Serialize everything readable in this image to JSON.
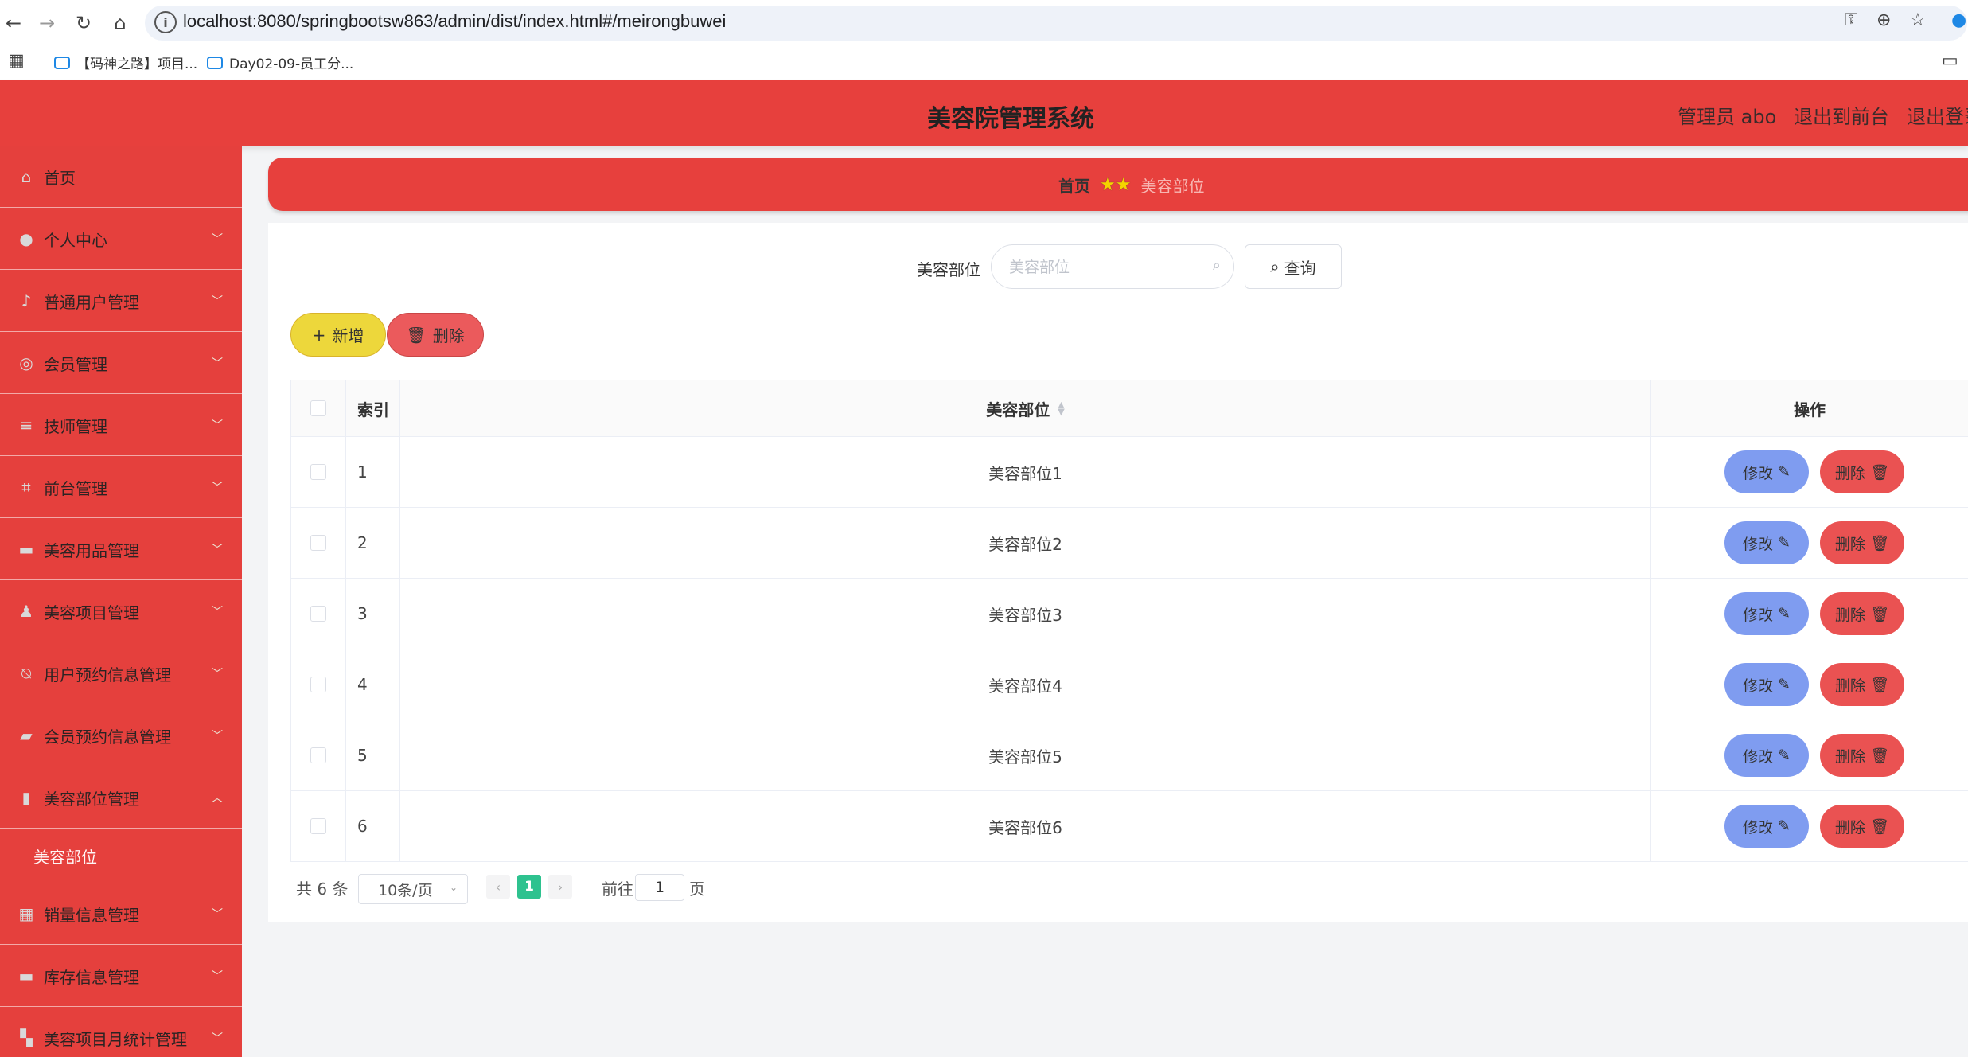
{
  "browser": {
    "url": "localhost:8080/springbootsw863/admin/dist/index.html#/meirongbuwei",
    "bookmarks": [
      "【码神之路】项目...",
      "Day02-09-员工分..."
    ]
  },
  "header": {
    "title": "美容院管理系统",
    "user": "管理员 abo",
    "to_front": "退出到前台",
    "logout": "退出登录"
  },
  "sidebar": {
    "items": [
      {
        "label": "首页",
        "icon": "home-icon",
        "glyph": "⌂"
      },
      {
        "label": "个人中心",
        "icon": "user-icon",
        "glyph": "●"
      },
      {
        "label": "普通用户管理",
        "icon": "microphone-icon",
        "glyph": "♪"
      },
      {
        "label": "会员管理",
        "icon": "target-icon",
        "glyph": "◎"
      },
      {
        "label": "技师管理",
        "icon": "sliders-icon",
        "glyph": "≡"
      },
      {
        "label": "前台管理",
        "icon": "crop-icon",
        "glyph": "⌗"
      },
      {
        "label": "美容用品管理",
        "icon": "monitor-icon",
        "glyph": "▬"
      },
      {
        "label": "美容项目管理",
        "icon": "person-icon",
        "glyph": "♟"
      },
      {
        "label": "用户预约信息管理",
        "icon": "bell-off-icon",
        "glyph": "⍉"
      },
      {
        "label": "会员预约信息管理",
        "icon": "wallet-icon",
        "glyph": "▰"
      },
      {
        "label": "美容部位管理",
        "icon": "bar-chart-icon",
        "glyph": "▮"
      },
      {
        "label": "销量信息管理",
        "icon": "grid-icon",
        "glyph": "▦"
      },
      {
        "label": "库存信息管理",
        "icon": "monitor-icon",
        "glyph": "▬"
      },
      {
        "label": "美容项目月统计管理",
        "icon": "ticket-icon",
        "glyph": "▚"
      }
    ],
    "sub_item": "美容部位"
  },
  "breadcrumb": {
    "home": "首页",
    "current": "美容部位"
  },
  "search": {
    "label": "美容部位",
    "placeholder": "美容部位",
    "query_button": "查询"
  },
  "actions": {
    "add": "新增",
    "delete": "删除"
  },
  "table": {
    "headers": {
      "index": "索引",
      "name": "美容部位",
      "ops": "操作"
    },
    "edit_label": "修改",
    "delete_label": "删除",
    "rows": [
      {
        "index": "1",
        "name": "美容部位1"
      },
      {
        "index": "2",
        "name": "美容部位2"
      },
      {
        "index": "3",
        "name": "美容部位3"
      },
      {
        "index": "4",
        "name": "美容部位4"
      },
      {
        "index": "5",
        "name": "美容部位5"
      },
      {
        "index": "6",
        "name": "美容部位6"
      }
    ]
  },
  "pagination": {
    "total": "共 6 条",
    "page_size": "10条/页",
    "current_page": "1",
    "goto_label": "前往",
    "goto_value": "1",
    "page_unit": "页"
  }
}
